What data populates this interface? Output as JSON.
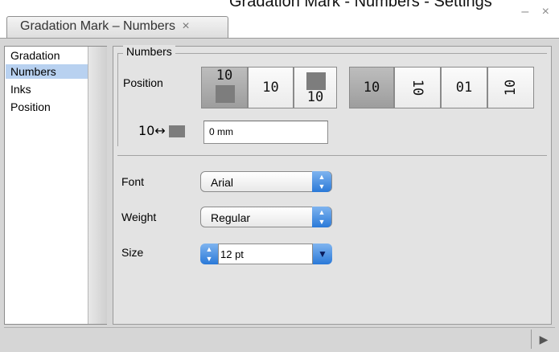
{
  "window": {
    "cut_title": "Gradation Mark - Numbers - Settings",
    "tab_title": "Gradation Mark – Numbers",
    "close_glyph": "×",
    "controls": "– ×"
  },
  "sidebar": {
    "items": [
      {
        "label": "Gradation"
      },
      {
        "label": "Numbers"
      },
      {
        "label": "Inks"
      },
      {
        "label": "Position"
      }
    ]
  },
  "numbers_group": {
    "title": "Numbers",
    "position_label": "Position",
    "position_buttons": [
      {
        "label": "10"
      },
      {
        "label": "10"
      },
      {
        "label": "10"
      }
    ],
    "orientation_buttons": [
      {
        "label": "10"
      },
      {
        "label": "10"
      },
      {
        "label": "01"
      },
      {
        "label": "10"
      }
    ],
    "offset_icon": "10↔",
    "offset_value": "0 mm"
  },
  "font": {
    "font_label": "Font",
    "font_value": "Arial",
    "weight_label": "Weight",
    "weight_value": "Regular",
    "size_label": "Size",
    "size_value": "12 pt"
  },
  "footer": {
    "play_glyph": "▶"
  }
}
